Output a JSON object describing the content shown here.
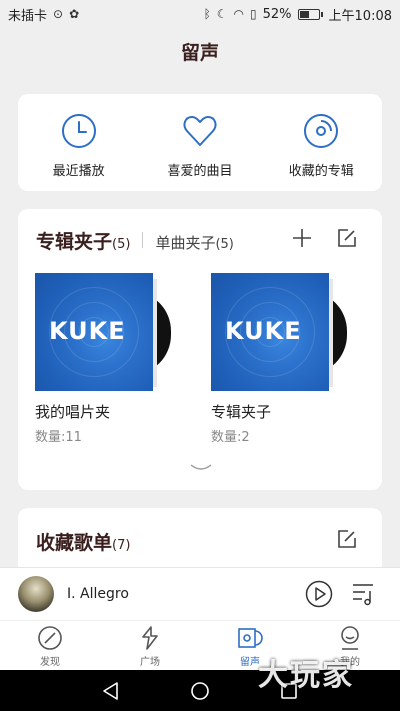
{
  "status_bar": {
    "carrier": "未插卡",
    "battery": "52%",
    "battery_level": 0.52,
    "time": "上午10:08"
  },
  "page_title": "留声",
  "quick_entries": [
    {
      "label": "最近播放",
      "icon": "clock-icon"
    },
    {
      "label": "喜爱的曲目",
      "icon": "heart-icon"
    },
    {
      "label": "收藏的专辑",
      "icon": "disc-icon"
    }
  ],
  "folders": {
    "tab_active": {
      "label": "专辑夹子",
      "count": "(5)"
    },
    "tab_inactive": {
      "label": "单曲夹子",
      "count": "(5)"
    },
    "albums": [
      {
        "name": "我的唱片夹",
        "qty": "数量:11",
        "logo": "KUKE"
      },
      {
        "name": "专辑夹子",
        "qty": "数量:2",
        "logo": "KUKE"
      }
    ]
  },
  "playlists": {
    "title": "收藏歌单",
    "count": "(7)"
  },
  "player": {
    "track": "I. Allegro"
  },
  "nav": [
    {
      "label": "发现",
      "icon": "compass-icon",
      "active": false
    },
    {
      "label": "广场",
      "icon": "square-icon",
      "active": false
    },
    {
      "label": "留声",
      "icon": "record-icon",
      "active": true
    },
    {
      "label": "我的",
      "icon": "profile-icon",
      "active": false
    }
  ],
  "watermark": "大玩家",
  "colors": {
    "accent": "#2f6ec6",
    "title": "#3a1f1f",
    "background": "#efefef",
    "cover_blue": "#1f5fb8"
  }
}
